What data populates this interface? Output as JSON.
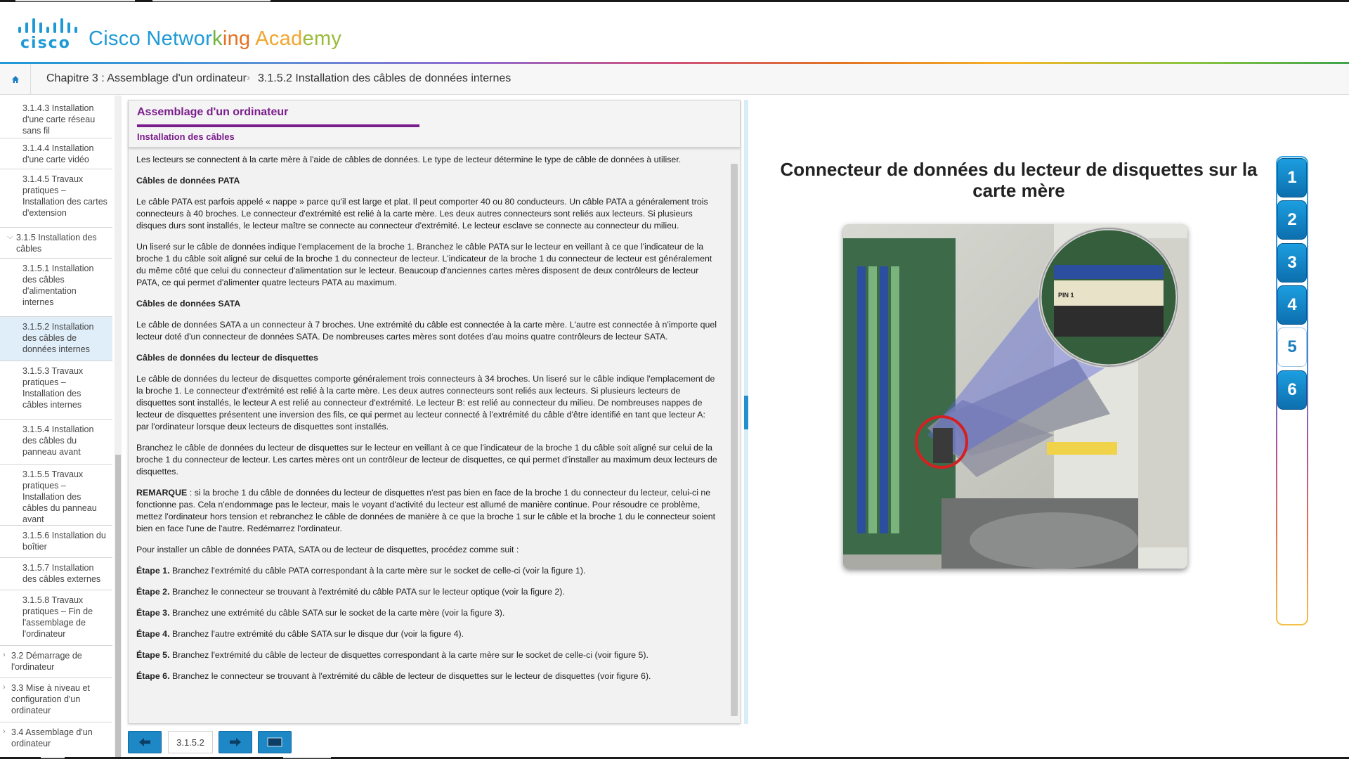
{
  "header": {
    "logo_word": "cisco",
    "brand_parts": [
      "Cisco Networ",
      "k",
      "ing",
      " Acad",
      "emy"
    ]
  },
  "breadcrumb": {
    "chapter": "Chapitre 3 : Assemblage d'un ordinateur",
    "page": "3.1.5.2 Installation des câbles de données internes"
  },
  "sidebar": {
    "items": [
      {
        "label": "3.1.4.3 Installation d'une carte réseau sans fil"
      },
      {
        "label": "3.1.4.4 Installation d'une carte vidéo"
      },
      {
        "label": "3.1.4.5 Travaux pratiques – Installation des cartes d'extension"
      },
      {
        "label": "3.1.5 Installation des câbles"
      },
      {
        "label": "3.1.5.1 Installation des câbles d'alimentation internes"
      },
      {
        "label": "3.1.5.2 Installation des câbles de données internes"
      },
      {
        "label": "3.1.5.3 Travaux pratiques – Installation des câbles internes"
      },
      {
        "label": "3.1.5.4 Installation des câbles du panneau avant"
      },
      {
        "label": "3.1.5.5 Travaux pratiques – Installation des câbles du panneau avant"
      },
      {
        "label": "3.1.5.6 Installation du boîtier"
      },
      {
        "label": "3.1.5.7 Installation des câbles externes"
      },
      {
        "label": "3.1.5.8 Travaux pratiques – Fin de l'assemblage de l'ordinateur"
      },
      {
        "label": "3.2 Démarrage de l'ordinateur"
      },
      {
        "label": "3.3 Mise à niveau et configuration d'un ordinateur"
      },
      {
        "label": "3.4 Assemblage d'un ordinateur"
      }
    ]
  },
  "panel": {
    "title": "Assemblage d'un ordinateur",
    "subtitle": "Installation des câbles",
    "paragraphs": [
      {
        "text": "Les lecteurs se connectent à la carte mère à l'aide de câbles de données. Le type de lecteur détermine le type de câble de données à utiliser."
      },
      {
        "heading": "Câbles de données PATA"
      },
      {
        "text": "Le câble PATA est parfois appelé « nappe » parce qu'il est large et plat. Il peut comporter 40 ou 80 conducteurs. Un câble PATA a généralement trois connecteurs à 40 broches. Le connecteur d'extrémité est relié à la carte mère. Les deux autres connecteurs sont reliés aux lecteurs. Si plusieurs disques durs sont installés, le lecteur maître se connecte au connecteur d'extrémité. Le lecteur esclave se connecte au connecteur du milieu."
      },
      {
        "text": "Un liseré sur le câble de données indique l'emplacement de la broche 1. Branchez le câble PATA sur le lecteur en veillant à ce que l'indicateur de la broche 1 du câble soit aligné sur celui de la broche 1 du connecteur de lecteur. L'indicateur de la broche 1 du connecteur de lecteur est généralement du même côté que celui du connecteur d'alimentation sur le lecteur. Beaucoup d'anciennes cartes mères disposent de deux contrôleurs de lecteur PATA, ce qui permet d'alimenter quatre lecteurs PATA au maximum."
      },
      {
        "heading": "Câbles de données SATA"
      },
      {
        "text": "Le câble de données SATA a un connecteur à 7 broches. Une extrémité du câble est connectée à la carte mère. L'autre est connectée à n'importe quel lecteur doté d'un connecteur de données SATA. De nombreuses cartes mères sont dotées d'au moins quatre contrôleurs de lecteur SATA."
      },
      {
        "heading": "Câbles de données du lecteur de disquettes"
      },
      {
        "text": "Le câble de données du lecteur de disquettes comporte généralement trois connecteurs à 34 broches. Un liseré sur le câble indique l'emplacement de la broche 1. Le connecteur d'extrémité est relié à la carte mère. Les deux autres connecteurs sont reliés aux lecteurs. Si plusieurs lecteurs de disquettes sont installés, le lecteur A est relié au connecteur d'extrémité. Le lecteur B: est relié au connecteur du milieu. De nombreuses nappes de lecteur de disquettes présentent une inversion des fils, ce qui permet au lecteur connecté à l'extrémité du câble d'être identifié en tant que lecteur A: par l'ordinateur lorsque deux lecteurs de disquettes sont installés."
      },
      {
        "text": "Branchez le câble de données du lecteur de disquettes sur le lecteur en veillant à ce que l'indicateur de la broche 1 du câble soit aligné sur celui de la broche 1 du connecteur de lecteur. Les cartes mères ont un contrôleur de lecteur de disquettes, ce qui permet d'installer au maximum deux lecteurs de disquettes."
      },
      {
        "lead": "REMARQUE",
        "text": " : si la broche 1 du câble de données du lecteur de disquettes n'est pas bien en face de la broche 1 du connecteur du lecteur, celui-ci ne fonctionne pas. Cela n'endommage pas le lecteur, mais le voyant d'activité du lecteur est allumé de manière continue. Pour résoudre ce problème, mettez l'ordinateur hors tension et rebranchez le câble de données de manière à ce que la broche 1 sur le câble et la broche 1 du le connecteur soient bien en face l'une de l'autre. Redémarrez l'ordinateur."
      },
      {
        "text": "Pour installer un câble de données PATA, SATA ou de lecteur de disquettes, procédez comme suit :"
      },
      {
        "lead": "Étape 1.",
        "text": " Branchez l'extrémité du câble PATA correspondant à la carte mère sur le socket de celle-ci (voir la figure 1)."
      },
      {
        "lead": "Étape 2.",
        "text": " Branchez le connecteur se trouvant à l'extrémité du câble PATA sur le lecteur optique (voir la figure 2)."
      },
      {
        "lead": "Étape 3.",
        "text": " Branchez une extrémité du câble SATA sur le socket de la carte mère (voir la figure 3)."
      },
      {
        "lead": "Étape 4.",
        "text": " Branchez l'autre extrémité du câble SATA sur le disque dur (voir la figure 4)."
      },
      {
        "lead": "Étape 5.",
        "text": " Branchez l'extrémité du câble de lecteur de disquettes correspondant à la carte mère sur le socket de celle-ci (voir figure 5)."
      },
      {
        "lead": "Étape 6.",
        "text": " Branchez le connecteur se trouvant à l'extrémité du câble de lecteur de disquettes sur le lecteur de disquettes (voir figure 6)."
      }
    ]
  },
  "nav": {
    "page_number": "3.1.5.2"
  },
  "media": {
    "title": "Connecteur de données du lecteur de disquettes sur la carte mère",
    "photo_label": "PIN 1"
  },
  "figures": {
    "tabs": [
      "1",
      "2",
      "3",
      "4",
      "5",
      "6"
    ],
    "active": "5"
  },
  "colors": {
    "accent": "#1d9ad6",
    "heading_purple": "#7b1d8d",
    "button_blue": "#1e88c7"
  }
}
